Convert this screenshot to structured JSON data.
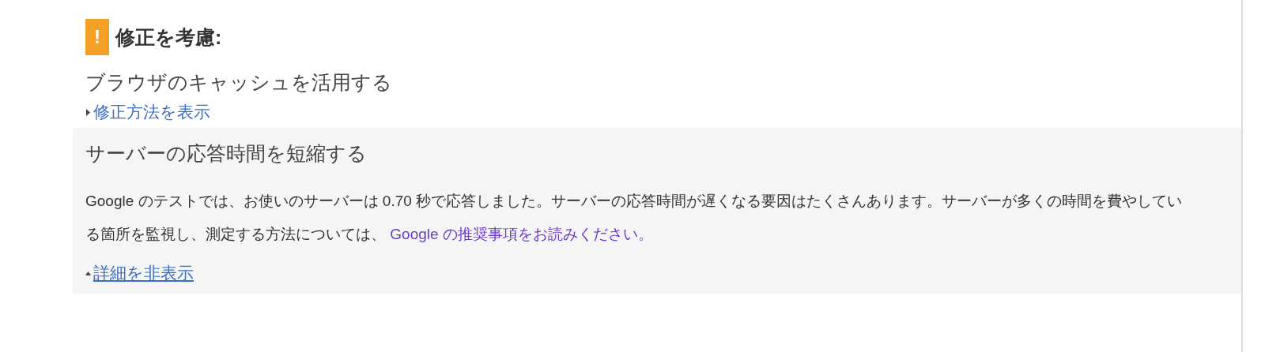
{
  "section": {
    "badge": "!",
    "title": "修正を考慮:"
  },
  "rules": [
    {
      "title": "ブラウザのキャッシュを活用する",
      "toggle": "修正方法を表示",
      "expanded": false
    },
    {
      "title": "サーバーの応答時間を短縮する",
      "toggle": "詳細を非表示",
      "expanded": true,
      "description": "Google のテストでは、お使いのサーバーは 0.70 秒で応答しました。サーバーの応答時間が遅くなる要因はたくさんあります。サーバーが多くの時間を費やしている箇所を監視し、測定する方法については、 ",
      "link": "Google の推奨事項をお読みください。"
    }
  ]
}
